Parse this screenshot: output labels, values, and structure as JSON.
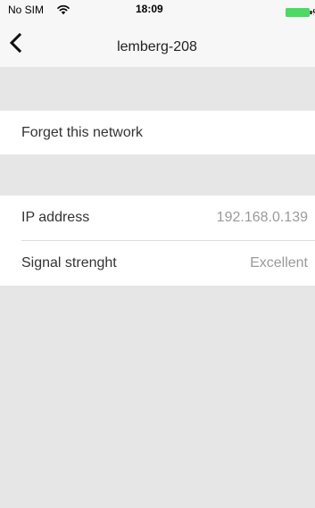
{
  "status_bar": {
    "carrier": "No SIM",
    "time": "18:09",
    "icons": [
      "wifi-icon",
      "battery-icon"
    ],
    "battery_color": "#4cd964"
  },
  "nav_bar": {
    "back_icon": "chevron-left-icon",
    "title": "lemberg-208"
  },
  "actions": {
    "forget_label": "Forget this network"
  },
  "info": {
    "rows": [
      {
        "label": "IP address",
        "value": "192.168.0.139"
      },
      {
        "label": "Signal strenght",
        "value": "Excellent"
      }
    ]
  },
  "colors": {
    "background": "#e6e6e6",
    "cell": "#ffffff",
    "value_text": "#9a9a9a"
  }
}
